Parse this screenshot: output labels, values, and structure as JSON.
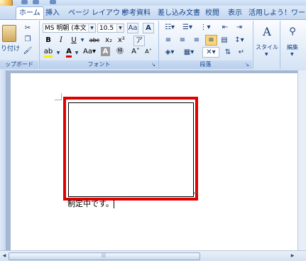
{
  "tabs": [
    {
      "label": "ホーム",
      "active": true
    },
    {
      "label": "挿入"
    },
    {
      "label": "ページ レイアウト"
    },
    {
      "label": "参考資料"
    },
    {
      "label": "差し込み文書"
    },
    {
      "label": "校閲"
    },
    {
      "label": "表示"
    },
    {
      "label": "活用しよう！ワード"
    }
  ],
  "clipboard": {
    "paste_label": "り付け",
    "group_label": "ップボード"
  },
  "font": {
    "name": "MS 明朝 (本文",
    "size": "10.5",
    "group_label": "フォント"
  },
  "paragraph": {
    "group_label": "段落"
  },
  "styles": {
    "label": "スタイル"
  },
  "editing": {
    "label": "編集"
  },
  "document": {
    "text": "制定中です。"
  }
}
